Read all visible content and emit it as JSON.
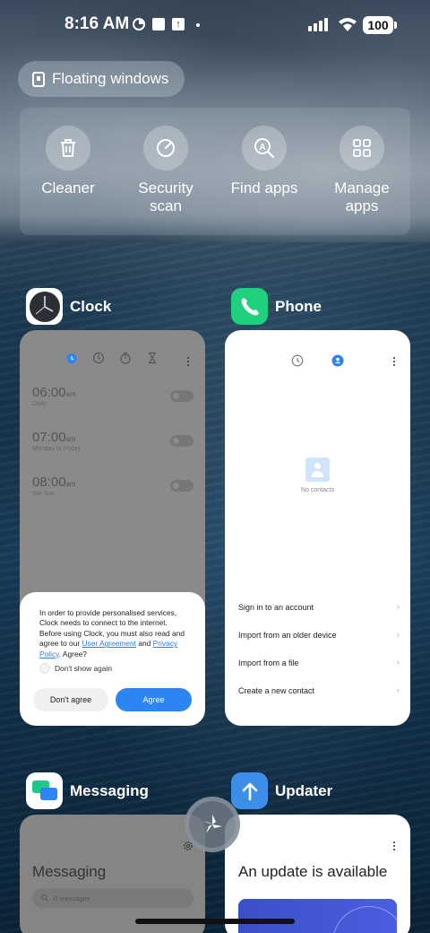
{
  "status_bar": {
    "time": "8:16 AM",
    "battery": "100"
  },
  "floating_windows": {
    "label": "Floating windows"
  },
  "quick_actions": [
    {
      "label": "Cleaner",
      "icon": "trash-icon"
    },
    {
      "label": "Security\nscan",
      "icon": "security-scan-icon"
    },
    {
      "label": "Find apps",
      "icon": "find-apps-icon"
    },
    {
      "label": "Manage\napps",
      "icon": "grid-icon"
    }
  ],
  "apps": {
    "clock": {
      "name": "Clock",
      "alarms": [
        {
          "time": "06:00",
          "ampm": "am",
          "repeat": "Daily"
        },
        {
          "time": "07:00",
          "ampm": "am",
          "repeat": "Monday to Friday"
        },
        {
          "time": "08:00",
          "ampm": "am",
          "repeat": "Sat Sun"
        }
      ],
      "dialog": {
        "text_before": "In order to provide personalised services, Clock needs to connect to the internet. Before using Clock, you must also read and agree to our ",
        "link_user_agreement": "User Agreement",
        "text_and": " and ",
        "link_privacy": "Privacy Policy",
        "text_after": ". Agree?",
        "checkbox_label": "Don't show again",
        "disagree_label": "Don't agree",
        "agree_label": "Agree"
      }
    },
    "phone": {
      "name": "Phone",
      "empty_text": "No contacts",
      "options": [
        "Sign in to an account",
        "Import from an older device",
        "Import from a file",
        "Create a new contact"
      ]
    },
    "messaging": {
      "name": "Messaging",
      "title": "Messaging",
      "search_placeholder": "0 messages"
    },
    "updater": {
      "name": "Updater",
      "title": "An update is available"
    }
  },
  "colors": {
    "phone_green": "#1fd07c",
    "updater_blue": "#3d8ee8",
    "agree_blue": "#2b86f3",
    "link_blue": "#2b7de9"
  }
}
